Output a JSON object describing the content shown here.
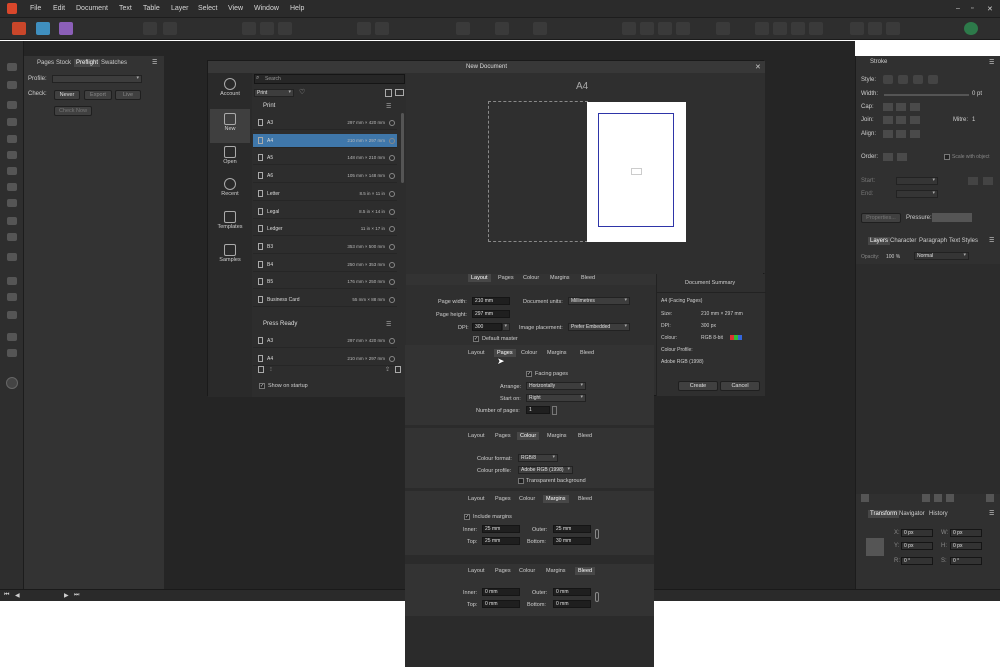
{
  "menubar": {
    "items": [
      "File",
      "Edit",
      "Document",
      "Text",
      "Table",
      "Layer",
      "Select",
      "View",
      "Window",
      "Help"
    ]
  },
  "left_panel": {
    "tabs": [
      "Pages",
      "Stock",
      "Preflight",
      "Swatches"
    ],
    "profile_label": "Profile:",
    "check_label": "Check:",
    "check_options": [
      "Never",
      "Export",
      "Live"
    ],
    "check_now": "Check Now"
  },
  "right_panel": {
    "stroke_title": "Stroke",
    "style_label": "Style:",
    "width_label": "Width:",
    "width_value": "0 pt",
    "cap_label": "Cap:",
    "join_label": "Join:",
    "mitre_label": "Mitre:",
    "mitre_value": "1",
    "align_label": "Align:",
    "order_label": "Order:",
    "scale_label": "Scale with object",
    "start_label": "Start:",
    "end_label": "End:",
    "properties_btn": "Properties...",
    "pressure_label": "Pressure:",
    "layer_tabs": [
      "Layers",
      "Character",
      "Paragraph",
      "Text Styles"
    ],
    "opacity_label": "Opacity:",
    "opacity_value": "100 %",
    "blend_value": "Normal",
    "transform_tabs": [
      "Transform",
      "Navigator",
      "History"
    ],
    "x_label": "X:",
    "x_value": "0 px",
    "y_label": "Y:",
    "y_value": "0 px",
    "w_label": "W:",
    "w_value": "0 px",
    "h_label": "H:",
    "h_value": "0 px",
    "r_label": "R:",
    "r_value": "0 °",
    "s_label": "S:",
    "s_value": "0 °"
  },
  "dialog": {
    "title": "New Document",
    "sidebar": [
      {
        "label": "Account",
        "icon": "account-icon"
      },
      {
        "label": "New",
        "icon": "new-doc-icon"
      },
      {
        "label": "Open",
        "icon": "folder-icon"
      },
      {
        "label": "Recent",
        "icon": "clock-icon"
      },
      {
        "label": "Templates",
        "icon": "templates-icon"
      },
      {
        "label": "Samples",
        "icon": "samples-icon"
      }
    ],
    "search_placeholder": "Search",
    "category": "Print",
    "group_print": "Print",
    "group_press": "Press Ready",
    "presets": [
      {
        "name": "A3",
        "size": "297 mm × 420 mm"
      },
      {
        "name": "A4",
        "size": "210 mm × 297 mm"
      },
      {
        "name": "A5",
        "size": "148 mm × 210 mm"
      },
      {
        "name": "A6",
        "size": "105 mm × 148 mm"
      },
      {
        "name": "Letter",
        "size": "8.5 in × 11 in"
      },
      {
        "name": "Legal",
        "size": "8.5 in × 14 in"
      },
      {
        "name": "Ledger",
        "size": "11 in × 17 in"
      },
      {
        "name": "B3",
        "size": "353 mm × 500 mm"
      },
      {
        "name": "B4",
        "size": "250 mm × 353 mm"
      },
      {
        "name": "B5",
        "size": "176 mm × 250 mm"
      },
      {
        "name": "Business Card",
        "size": "55 mm × 88 mm"
      }
    ],
    "press_presets": [
      {
        "name": "A3",
        "size": "297 mm × 420 mm"
      },
      {
        "name": "A4",
        "size": "210 mm × 297 mm"
      }
    ],
    "show_on_startup": "Show on startup",
    "preview_title": "A4",
    "tabs": [
      "Layout",
      "Pages",
      "Colour",
      "Margins",
      "Bleed"
    ],
    "page_width_label": "Page width:",
    "page_width": "210 mm",
    "page_height_label": "Page height:",
    "page_height": "297 mm",
    "dpi_label": "DPI:",
    "dpi": "300",
    "doc_units_label": "Document units:",
    "doc_units": "Millimetres",
    "image_placement_label": "Image placement:",
    "image_placement": "Prefer Embedded",
    "default_master": "Default master",
    "summary_title": "Document Summary",
    "summary_name": "A4 (Facing Pages)",
    "summary_size_label": "Size:",
    "summary_size": "210 mm  ×  297 mm",
    "summary_dpi_label": "DPI:",
    "summary_dpi": "300 px",
    "summary_colour_label": "Colour:",
    "summary_colour": "RGB 8-bit",
    "summary_profile_label": "Colour Profile:",
    "summary_profile": "Adobe RGB (1998)",
    "create": "Create",
    "cancel": "Cancel"
  },
  "expanded": {
    "facing_pages": "Facing pages",
    "arrange_label": "Arrange:",
    "arrange": "Horizontally",
    "start_on_label": "Start on:",
    "start_on": "Right",
    "num_pages_label": "Number of pages:",
    "num_pages": "1",
    "colour_format_label": "Colour format:",
    "colour_format": "RGB/8",
    "colour_profile_label": "Colour profile:",
    "colour_profile": "Adobe RGB (1998)",
    "transparent_bg": "Transparent background",
    "include_margins": "Include margins",
    "inner_label": "Inner:",
    "outer_label": "Outer:",
    "top_label": "Top:",
    "bottom_label": "Bottom:",
    "m_inner": "25 mm",
    "m_outer": "25 mm",
    "m_top": "25 mm",
    "m_bottom": "30 mm",
    "b_inner": "0 mm",
    "b_outer": "0 mm",
    "b_top": "0 mm",
    "b_bottom": "0 mm"
  }
}
